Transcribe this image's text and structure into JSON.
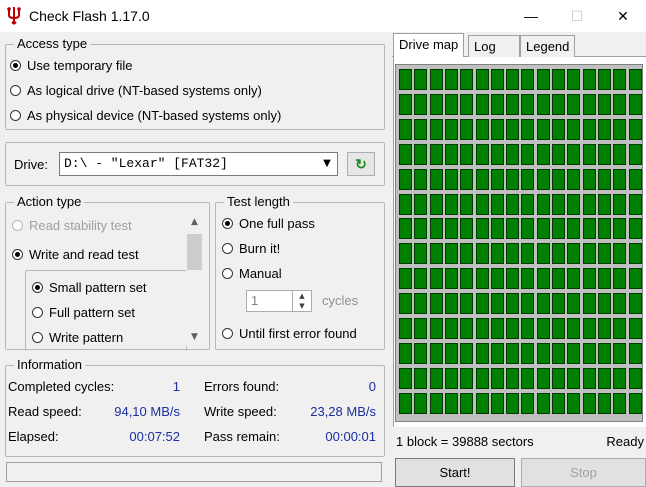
{
  "window": {
    "title": "Check Flash 1.17.0",
    "minimize": "—",
    "maximize": "☐",
    "close": "✕"
  },
  "access_type": {
    "title": "Access type",
    "options": [
      "Use temporary file",
      "As logical drive (NT-based systems only)",
      "As physical device (NT-based systems only)"
    ],
    "selected": 0
  },
  "drive": {
    "label": "Drive:",
    "value": "D:\\ - \"Lexar\" [FAT32]",
    "dropdown_icon": "▼",
    "refresh_icon": "↻"
  },
  "action_type": {
    "title": "Action type",
    "options": [
      "Read stability test",
      "Write and read test"
    ],
    "sub_options": [
      "Small pattern set",
      "Full pattern set",
      "Write pattern"
    ],
    "selected": 1,
    "sub_selected": 0
  },
  "test_length": {
    "title": "Test length",
    "options": [
      "One full pass",
      "Burn it!",
      "Manual",
      "Until first error found"
    ],
    "selected": 0,
    "cycles_value": "1",
    "cycles_label": "cycles"
  },
  "information": {
    "title": "Information",
    "completed_cycles_label": "Completed cycles:",
    "completed_cycles": "1",
    "errors_found_label": "Errors found:",
    "errors_found": "0",
    "read_speed_label": "Read speed:",
    "read_speed": "94,10 MB/s",
    "write_speed_label": "Write speed:",
    "write_speed": "23,28 MB/s",
    "elapsed_label": "Elapsed:",
    "elapsed": "00:07:52",
    "pass_remain_label": "Pass remain:",
    "pass_remain": "00:00:01"
  },
  "tabs": [
    "Drive map",
    "Log",
    "Legend"
  ],
  "drive_map": {
    "columns": 16,
    "rows": 14,
    "cell_color": "#008000",
    "cell_border": "#003c00"
  },
  "status": {
    "block_info": "1 block = 39888 sectors",
    "state": "Ready"
  },
  "buttons": {
    "start": "Start!",
    "stop": "Stop"
  }
}
